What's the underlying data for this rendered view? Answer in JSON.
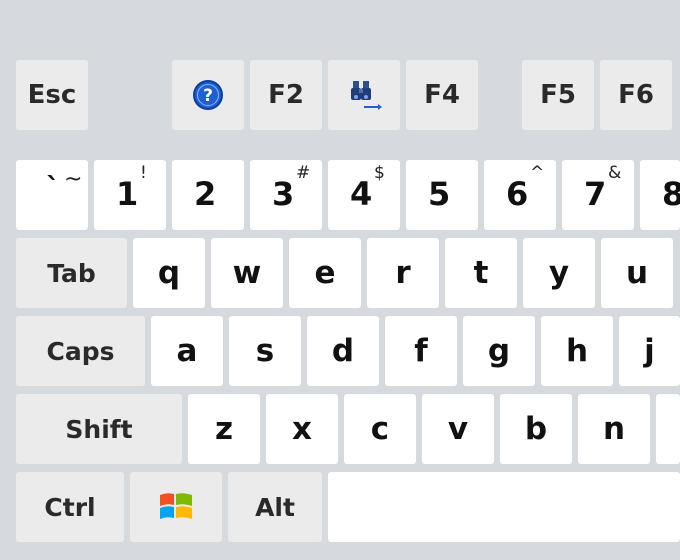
{
  "function_row": {
    "esc": "Esc",
    "f2": "F2",
    "f4": "F4",
    "f5": "F5",
    "f6": "F6",
    "help_icon": "help-question-icon",
    "search_icon": "binoculars-search-icon"
  },
  "number_row": [
    {
      "main": "`",
      "shift": "~"
    },
    {
      "main": "1",
      "shift": "!"
    },
    {
      "main": "2",
      "shift": ""
    },
    {
      "main": "3",
      "shift": "#"
    },
    {
      "main": "4",
      "shift": "$"
    },
    {
      "main": "5",
      "shift": ""
    },
    {
      "main": "6",
      "shift": "^"
    },
    {
      "main": "7",
      "shift": "&"
    },
    {
      "main": "8",
      "shift": ""
    }
  ],
  "modifiers": {
    "tab": "Tab",
    "caps": "Caps",
    "shift": "Shift",
    "ctrl": "Ctrl",
    "alt": "Alt",
    "windows_icon": "windows-logo-icon"
  },
  "row_q": [
    "q",
    "w",
    "e",
    "r",
    "t",
    "y",
    "u"
  ],
  "row_a": [
    "a",
    "s",
    "d",
    "f",
    "g",
    "h",
    "j"
  ],
  "row_z": [
    "z",
    "x",
    "c",
    "v",
    "b",
    "n"
  ],
  "colors": {
    "background": "#d6d9de",
    "key": "#ffffff",
    "function_key": "#ebebeb",
    "help_blue": "#1e5fd6",
    "win_red": "#f25022",
    "win_green": "#7fba00",
    "win_blue": "#00a4ef",
    "win_yellow": "#ffb900"
  }
}
